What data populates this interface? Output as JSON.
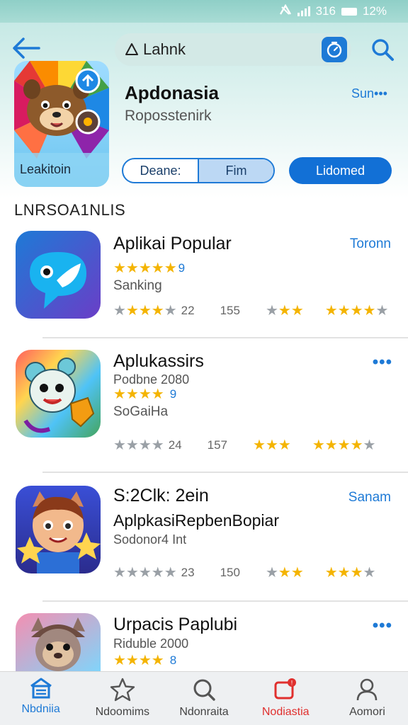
{
  "status_bar": {
    "network": "316",
    "battery": "12%"
  },
  "search": {
    "query": "Lahnk"
  },
  "app": {
    "title": "Apdonasia",
    "subtitle": "Roposstenirk",
    "more_link": "Sun•••",
    "icon_label": "Leakitoin",
    "segments": [
      "Deane:",
      "Fim"
    ],
    "primary_button": "Lidomed"
  },
  "section_title": "LNRSOA1NLIS",
  "items": [
    {
      "title": "Aplikai Popular",
      "subtitle": "",
      "rating_text": "9",
      "category": "Sanking",
      "action": "Toronn",
      "stats": [
        "22",
        "155"
      ]
    },
    {
      "title": "Aplukassirs",
      "subtitle": "Podbne 2080",
      "rating_text": "9",
      "category": "SoGaiHa",
      "action": "•••",
      "stats": [
        "24",
        "157"
      ]
    },
    {
      "title": "S:2Clk: 2ein",
      "title2": "AplpkasiRepbenBopiar",
      "subtitle": "Sodonor4 Int",
      "category": "",
      "action": "Sanam",
      "stats": [
        "23",
        "150"
      ]
    },
    {
      "title": "Urpacis Paplubi",
      "subtitle": "Riduble 2000",
      "rating_text": "8",
      "category": "",
      "action": "•••",
      "stats": []
    }
  ],
  "nav": [
    {
      "label": "Nbdniia",
      "icon": "home-icon"
    },
    {
      "label": "Ndoomims",
      "icon": "star-icon"
    },
    {
      "label": "Ndonraita",
      "icon": "search-icon"
    },
    {
      "label": "Nodiastia",
      "icon": "notification-icon"
    },
    {
      "label": "Aomori",
      "icon": "profile-icon"
    }
  ],
  "colors": {
    "accent": "#1e7ad6",
    "star": "#f4b400",
    "alert": "#e0302e"
  }
}
